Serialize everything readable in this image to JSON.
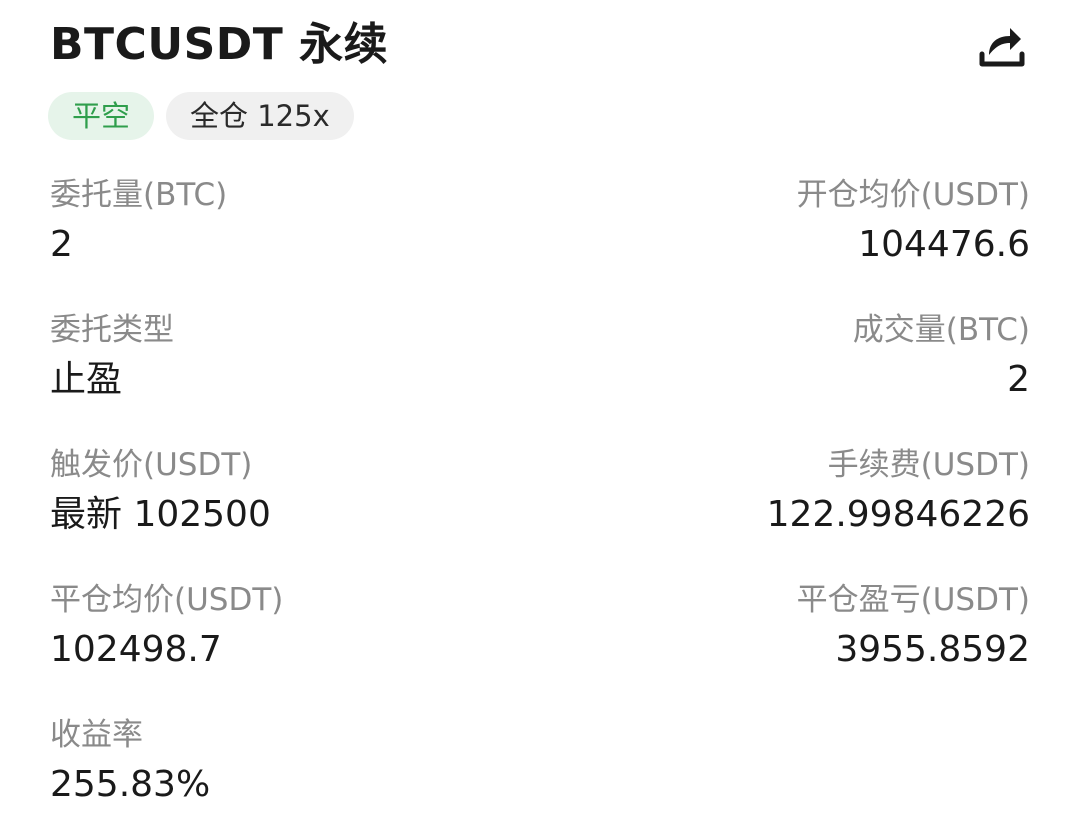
{
  "header": {
    "title": "BTCUSDT 永续",
    "share_icon": "share-icon"
  },
  "tags": {
    "side": "平空",
    "margin_mode": "全仓 125x"
  },
  "colors": {
    "side_tag_bg": "#e6f4ea",
    "side_tag_text": "#2f9e4c",
    "mode_tag_bg": "#f0f0f0",
    "label_text": "#8a8a8a",
    "value_text": "#1a1a1a"
  },
  "details": {
    "order_qty": {
      "label": "委托量(BTC)",
      "value": "2"
    },
    "open_avg_price": {
      "label": "开仓均价(USDT)",
      "value": "104476.6"
    },
    "order_type": {
      "label": "委托类型",
      "value": "止盈"
    },
    "filled_qty": {
      "label": "成交量(BTC)",
      "value": "2"
    },
    "trigger_price": {
      "label": "触发价(USDT)",
      "value": "最新 102500"
    },
    "fee": {
      "label": "手续费(USDT)",
      "value": "122.99846226"
    },
    "close_avg_price": {
      "label": "平仓均价(USDT)",
      "value": "102498.7"
    },
    "close_pnl": {
      "label": "平仓盈亏(USDT)",
      "value": "3955.8592"
    },
    "roi": {
      "label": "收益率",
      "value": "255.83%"
    }
  }
}
